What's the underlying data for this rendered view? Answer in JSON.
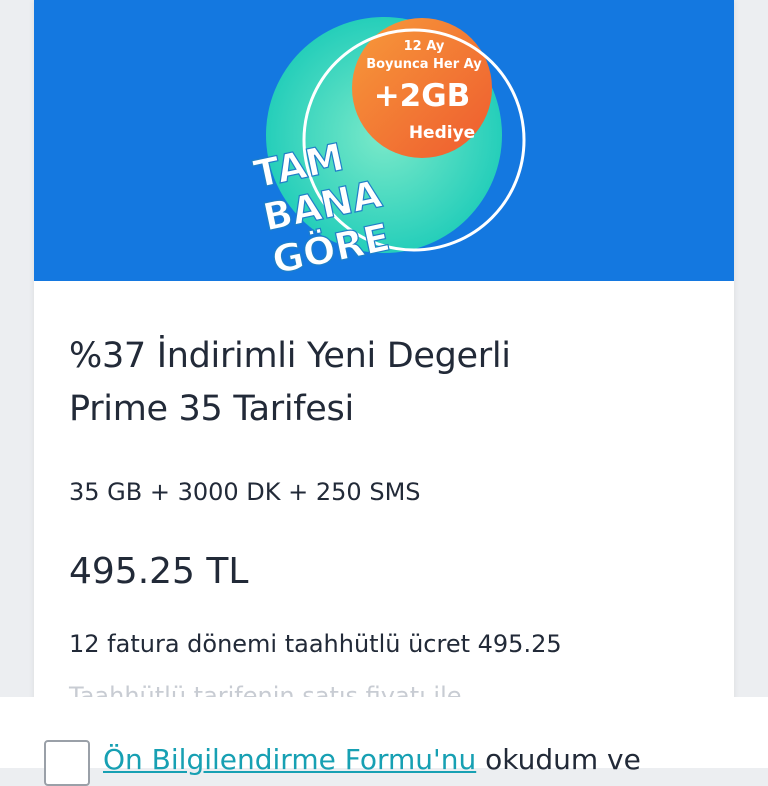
{
  "promo": {
    "line1": "12 Ay",
    "line2": "Boyunca Her Ay",
    "gift_amount": "+2GB",
    "gift_label": "Hediye",
    "slogan_1": "TAM",
    "slogan_2": "BANA",
    "slogan_3": "GÖRE",
    "colors": {
      "banner": "#1478e0",
      "orange": "#f2703a",
      "teal": "#2fd6b8",
      "slogan": "#ffffff"
    }
  },
  "tariff": {
    "title_line1": "%37 İndirimli Yeni Degerli",
    "title_line2": "Prime 35 Tarifesi",
    "allowance": "35 GB + 3000 DK + 250 SMS",
    "price": "495.25 TL",
    "commitment": "12 fatura dönemi taahhütlü ücret 495.25",
    "clipped_text": "Taahhütlü tarifenin satış fiyatı ile"
  },
  "consent": {
    "link_text": "Ön Bilgilendirme Formu'nu",
    "rest_text": " okudum ve"
  }
}
